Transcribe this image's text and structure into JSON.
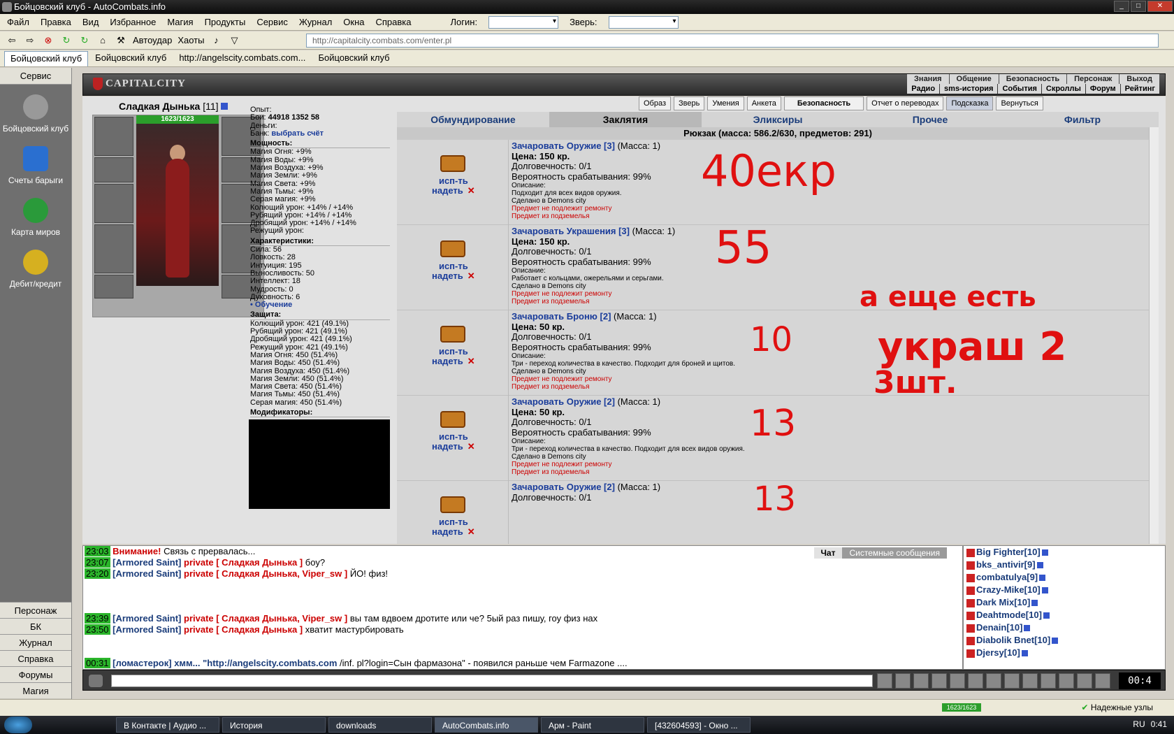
{
  "window": {
    "title": "Бойцовский клуб - AutoCombats.info"
  },
  "menu": {
    "items": [
      "Файл",
      "Правка",
      "Вид",
      "Избранное",
      "Магия",
      "Продукты",
      "Сервис",
      "Журнал",
      "Окна",
      "Справка"
    ],
    "login_label": "Логин:",
    "beast_label": "Зверь:"
  },
  "toolbar": {
    "autoudar": "Автоудар",
    "haoty": "Хаоты"
  },
  "address": {
    "url": "http://capitalcity.combats.com/enter.pl"
  },
  "tabs": [
    "Бойцовский клуб",
    "Бойцовский клуб",
    "http://angelscity.combats.com...",
    "Бойцовский клуб"
  ],
  "left": {
    "header": "Сервис",
    "items": [
      "Бойцовский клуб",
      "Счеты барыги",
      "Карта миров",
      "Дебит/кредит"
    ],
    "bottom": [
      "Персонаж",
      "БК",
      "Журнал",
      "Справка",
      "Форумы",
      "Магия"
    ]
  },
  "game": {
    "logo": "CAPITALCITY",
    "topnav": [
      "Знания",
      "Общение",
      "Безопасность",
      "Персонаж",
      "Выход"
    ],
    "topnav2": [
      "Радио",
      "sms-история",
      "События",
      "Скроллы",
      "Форум",
      "Рейтинг"
    ],
    "char_name": "Сладкая Дынька",
    "char_level": "[11]",
    "hp": "1623/1623",
    "buttons": [
      "Образ",
      "Зверь",
      "Умения",
      "Анкета",
      "Безопасность",
      "Отчет о переводах",
      "Подсказка",
      "Вернуться"
    ],
    "inv_tabs": [
      "Обмундирование",
      "Заклятия",
      "Эликсиры",
      "Прочее",
      "Фильтр"
    ],
    "backpack": "Рюкзак (масса: 586.2/630, предметов: 291)"
  },
  "stats": {
    "exp": "Опыт:",
    "fights": "Бои:",
    "fights_val": "44918",
    "fights_val2": "1352",
    "fights_val3": "58",
    "money": "Деньги:",
    "bank": "Банк:",
    "bank_link": "выбрать счёт",
    "power_hdr": "Мощность:",
    "power": [
      "Магия Огня: +9%",
      "Магия Воды: +9%",
      "Магия Воздуха: +9%",
      "Магия Земли: +9%",
      "Магия Света: +9%",
      "Магия Тьмы: +9%",
      "Серая магия: +9%",
      "Колющий урон: +14% / +14%",
      "Рубящий урон: +14% / +14%",
      "Дробящий урон: +14% / +14%",
      "Режущий урон:"
    ],
    "char_hdr": "Характеристики:",
    "chars": [
      "Сила: 56",
      "Ловкость: 28",
      "Интуиция: 195",
      "Выносливость: 50",
      "Интеллект: 18",
      "Мудрость: 0",
      "Духовность: 6"
    ],
    "training": "• Обучение",
    "def_hdr": "Защита:",
    "defs": [
      "Колющий урон: 421 (49.1%)",
      "Рубящий урон: 421 (49.1%)",
      "Дробящий урон: 421 (49.1%)",
      "Режущий урон: 421 (49.1%)",
      "Магия Огня: 450 (51.4%)",
      "Магия Воды: 450 (51.4%)",
      "Магия Воздуха: 450 (51.4%)",
      "Магия Земли: 450 (51.4%)",
      "Магия Света: 450 (51.4%)",
      "Магия Тьмы: 450 (51.4%)",
      "Серая магия: 450 (51.4%)"
    ],
    "mod_hdr": "Модификаторы:"
  },
  "items": [
    {
      "title": "Зачаровать Оружие [3]",
      "mass": "(Масса: 1)",
      "price": "Цена: 150 кр.",
      "dur": "Долговечность: 0/1",
      "prob": "Вероятность срабатывания: 99%",
      "desc_hdr": "Описание:",
      "desc": "Подходит для всех видов оружия.",
      "made": "Сделано в Demons city",
      "r1": "Предмет не подлежит ремонту",
      "r2": "Предмет из подземелья"
    },
    {
      "title": "Зачаровать Украшения [3]",
      "mass": "(Масса: 1)",
      "price": "Цена: 150 кр.",
      "dur": "Долговечность: 0/1",
      "prob": "Вероятность срабатывания: 99%",
      "desc_hdr": "Описание:",
      "desc": "Работает с кольцами, ожерельями и серьгами.",
      "made": "Сделано в Demons city",
      "r1": "Предмет не подлежит ремонту",
      "r2": "Предмет из подземелья"
    },
    {
      "title": "Зачаровать Броню [2]",
      "mass": "(Масса: 1)",
      "price": "Цена: 50 кр.",
      "dur": "Долговечность: 0/1",
      "prob": "Вероятность срабатывания: 99%",
      "desc_hdr": "Описание:",
      "desc": "Три - переход количества в качество. Подходит для броней и щитов.",
      "made": "Сделано в Demons city",
      "r1": "Предмет не подлежит ремонту",
      "r2": "Предмет из подземелья"
    },
    {
      "title": "Зачаровать Оружие [2]",
      "mass": "(Масса: 1)",
      "price": "Цена: 50 кр.",
      "dur": "Долговечность: 0/1",
      "prob": "Вероятность срабатывания: 99%",
      "desc_hdr": "Описание:",
      "desc": "Три - переход количества в качество. Подходит для всех видов оружия.",
      "made": "Сделано в Demons city",
      "r1": "Предмет не подлежит ремонту",
      "r2": "Предмет из подземелья"
    },
    {
      "title": "Зачаровать Оружие [2]",
      "mass": "(Масса: 1)",
      "price": "",
      "dur": "Долговечность: 0/1",
      "prob": "",
      "desc_hdr": "",
      "desc": "",
      "made": "",
      "r1": "",
      "r2": ""
    }
  ],
  "item_actions": {
    "use": "исп-ть",
    "wear": "надеть",
    "del": "✕"
  },
  "annotations": [
    "40екр",
    "55",
    "10",
    "13",
    "13",
    "а еще есть",
    "украш 2",
    "3шт."
  ],
  "chat": {
    "tabs": [
      "Чат",
      "Системные сообщения"
    ],
    "lines": [
      {
        "t": "23:03",
        "a": "Внимание!",
        "b": " Связь с",
        "c": "",
        "d": " прервалась..."
      },
      {
        "t": "23:07",
        "a": "[Armored Saint]",
        "b": " private [ Сладкая Дынька ]",
        "c": " бoy?"
      },
      {
        "t": "23:20",
        "a": "[Armored Saint]",
        "b": " private [ Сладкая Дынька, Viper_sw ]",
        "c": " ЙО! физ!"
      },
      {
        "t": "23:39",
        "a": "[Armored Saint]",
        "b": " private [ Сладкая Дынька, Viper_sw ]",
        "c": " вы там вдвоем дротите или че? 5ый раз пишу, гоу физ нах"
      },
      {
        "t": "23:50",
        "a": "[Armored Saint]",
        "b": " private [ Сладкая Дынька ]",
        "c": " хватит мастурбировать"
      },
      {
        "t": "00:31",
        "a": "[ломастерок]",
        "b": " хмм... \"http://angelscity.combats.com",
        "c": " /inf. pl?login=Сын фармазона\" - появился раньше чем Farmazone ...."
      }
    ]
  },
  "users": [
    "Big Fighter[10]",
    "bks_antivir[9]",
    "combatulya[9]",
    "Crazy-Mike[10]",
    "Dark Mix[10]",
    "Deahtmode[10]",
    "Denain[10]",
    "Diabolik Bnet[10]",
    "Djersy[10]"
  ],
  "clock": "00:4",
  "status": {
    "hp": "1623/1623",
    "safe": "Надежные узлы"
  },
  "taskbar": {
    "tasks": [
      "В Контакте | Аудио ...",
      "История",
      "downloads",
      "AutoCombats.info",
      "Арм - Paint",
      "[432604593] - Окно ..."
    ],
    "lang": "RU",
    "time": "0:41"
  }
}
